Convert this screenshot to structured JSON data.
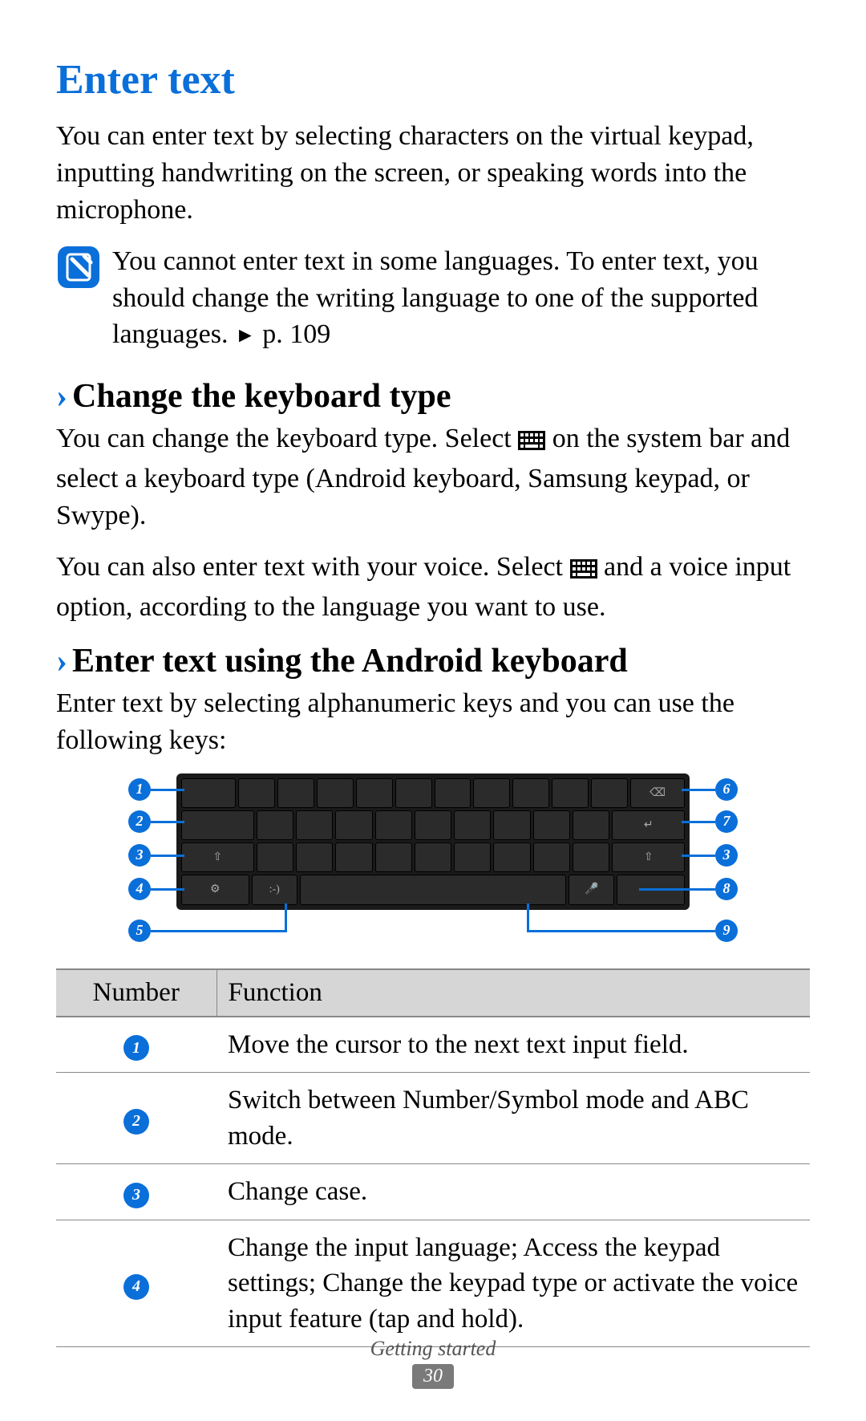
{
  "title": "Enter text",
  "intro": "You can enter text by selecting characters on the virtual keypad, inputting handwriting on the screen, or speaking words into the microphone.",
  "note": {
    "pre": "You cannot enter text in some languages. To enter text, you should change the writing language to one of the supported languages. ",
    "tri": "►",
    "ref": " p. 109"
  },
  "sub1": {
    "chev": "›",
    "title": "Change the keyboard type",
    "p1a": "You can change the keyboard type. Select ",
    "p1b": " on the system bar and select a keyboard type (Android keyboard, Samsung keypad, or Swype).",
    "p2a": "You can also enter text with your voice. Select ",
    "p2b": " and a voice input option, according to the language you want to use."
  },
  "sub2": {
    "chev": "›",
    "title": "Enter text using the Android keyboard",
    "p1": "Enter text by selecting alphanumeric keys and you can use the following keys:"
  },
  "callouts": {
    "c1": "1",
    "c2": "2",
    "c3": "3",
    "c4": "4",
    "c5": "5",
    "c6": "6",
    "c7": "7",
    "c8": "8",
    "c9": "9"
  },
  "table": {
    "h1": "Number",
    "h2": "Function",
    "rows": [
      {
        "n": "1",
        "f": "Move the cursor to the next text input field."
      },
      {
        "n": "2",
        "f": "Switch between Number/Symbol mode and ABC mode."
      },
      {
        "n": "3",
        "f": "Change case."
      },
      {
        "n": "4",
        "f": "Change the input language; Access the keypad settings; Change the keypad type or activate the voice input feature (tap and hold)."
      }
    ]
  },
  "footer": {
    "section": "Getting started",
    "page": "30"
  }
}
